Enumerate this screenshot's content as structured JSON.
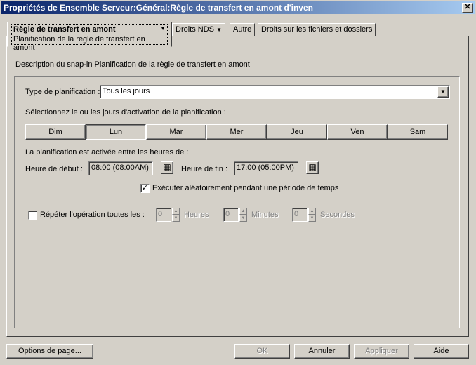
{
  "window": {
    "title": "Propriétés de Ensemble Serveur:Général:Règle de transfert en amont d'inven",
    "close": "✕"
  },
  "tabs": [
    {
      "label": "Règle de transfert en amont",
      "sublabel": "Planification de la règle de transfert en amont",
      "dropdown": "▼"
    },
    {
      "label": "Droits NDS",
      "dropdown": "▼"
    },
    {
      "label": "Autre"
    },
    {
      "label": "Droits sur les fichiers et dossiers"
    }
  ],
  "main": {
    "description": "Description du snap-in Planification de la règle de transfert en amont",
    "type_label": "Type de planification :",
    "type_value": "Tous les jours",
    "days_label": "Sélectionnez le ou les jours d'activation de la planification :",
    "days": [
      {
        "label": "Dim",
        "selected": false
      },
      {
        "label": "Lun",
        "selected": true
      },
      {
        "label": "Mar",
        "selected": false
      },
      {
        "label": "Mer",
        "selected": false
      },
      {
        "label": "Jeu",
        "selected": false
      },
      {
        "label": "Ven",
        "selected": false
      },
      {
        "label": "Sam",
        "selected": false
      }
    ],
    "hours_label": "La planification est activée entre les heures de :",
    "start_label": "Heure de début :",
    "start_value": "08:00 (08:00AM)",
    "end_label": "Heure de fin :",
    "end_value": "17:00 (05:00PM)",
    "random_label": "Exécuter aléatoirement pendant une période de temps",
    "random_checked": true,
    "repeat_label": "Répéter l'opération toutes les :",
    "repeat_checked": false,
    "hours_value": "0",
    "hours_unit": "Heures",
    "minutes_value": "0",
    "minutes_unit": "Minutes",
    "seconds_value": "0",
    "seconds_unit": "Secondes"
  },
  "footer": {
    "page_options": "Options de page...",
    "ok": "OK",
    "cancel": "Annuler",
    "apply": "Appliquer",
    "help": "Aide"
  }
}
